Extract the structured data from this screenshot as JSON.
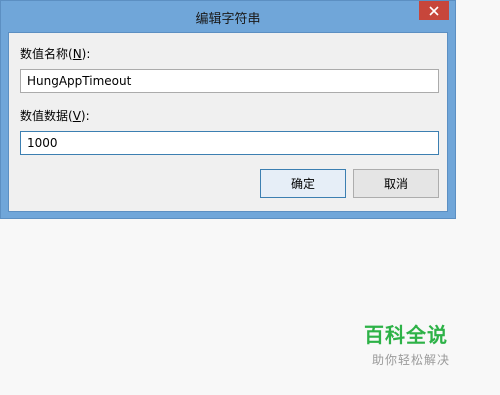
{
  "dialog": {
    "title": "编辑字符串",
    "close_icon": "close-icon",
    "value_name": {
      "label_prefix": "数值名称(",
      "mnemonic": "N",
      "label_suffix": "):",
      "value": "HungAppTimeout"
    },
    "value_data": {
      "label_prefix": "数值数据(",
      "mnemonic": "V",
      "label_suffix": "):",
      "value": "1000"
    },
    "ok_label": "确定",
    "cancel_label": "取消"
  },
  "watermark": {
    "logo": "百科全说",
    "tagline": "助你轻松解决"
  },
  "colors": {
    "titlebar": "#70a6d9",
    "close_button": "#c7463b",
    "watermark_green": "#2db247"
  }
}
